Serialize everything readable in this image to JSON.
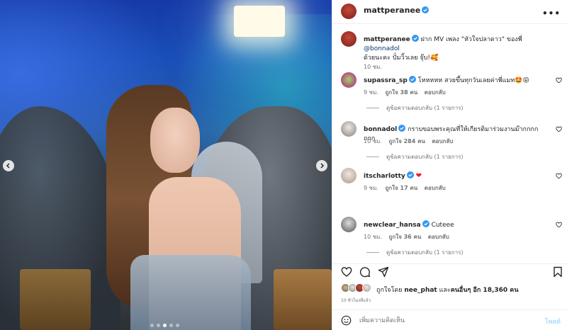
{
  "post": {
    "username": "mattperanee",
    "more_label": "•••"
  },
  "caption": {
    "username": "mattperanee",
    "text": "ฝาก MV เพลง \"หัวใจปลาดาว\" ของพี่ ",
    "mention": "@bonnadol",
    "text2": "ด้วยนะคะ ปั๋มวิ้วเลย จุ๊บ!🥰",
    "time": "10 ชม."
  },
  "comments": [
    {
      "username": "supassra_sp",
      "text": "โหหหหห สวยขึ้นทุกวันเลยค่าพี่แมท🤩😝",
      "time": "9 ชม.",
      "likes": "ถูกใจ 38 คน",
      "reply": "ตอบกลับ",
      "view_replies": "ดูข้อความตอบกลับ (1 รายการ)"
    },
    {
      "username": "bonnadol",
      "text": "กราบขอบพระคุณที่ให้เกียรติมาร่วมงานม๊ากกกกกกก",
      "time": "10 ชม.",
      "likes": "ถูกใจ 284 คน",
      "reply": "ตอบกลับ",
      "view_replies": "ดูข้อความตอบกลับ (1 รายการ)"
    },
    {
      "username": "itscharlotty",
      "text": "❤",
      "time": "9 ชม.",
      "likes": "ถูกใจ 17 คน",
      "reply": "ตอบกลับ"
    },
    {
      "username": "newclear_hansa",
      "text": "Cuteee",
      "time": "10 ชม.",
      "likes": "ถูกใจ 36 คน",
      "reply": "ตอบกลับ",
      "view_replies": "ดูข้อความตอบกลับ (1 รายการ)"
    }
  ],
  "likes": {
    "prefix": "ถูกใจโดย ",
    "user": "nee_phat",
    "middle": " และ",
    "others": "คนอื่นๆ อีก 18,360 คน"
  },
  "timeago": "10 ชั่วโมงที่แล้ว",
  "add_comment": {
    "placeholder": "เพิ่มความคิดเห็น",
    "post_label": "โพสต์"
  },
  "carousel": {
    "total_slides": 5,
    "active_index": 2
  },
  "colors": {
    "verified": "#3897f0",
    "link": "#00376b",
    "post_button": "#b2dffc"
  }
}
